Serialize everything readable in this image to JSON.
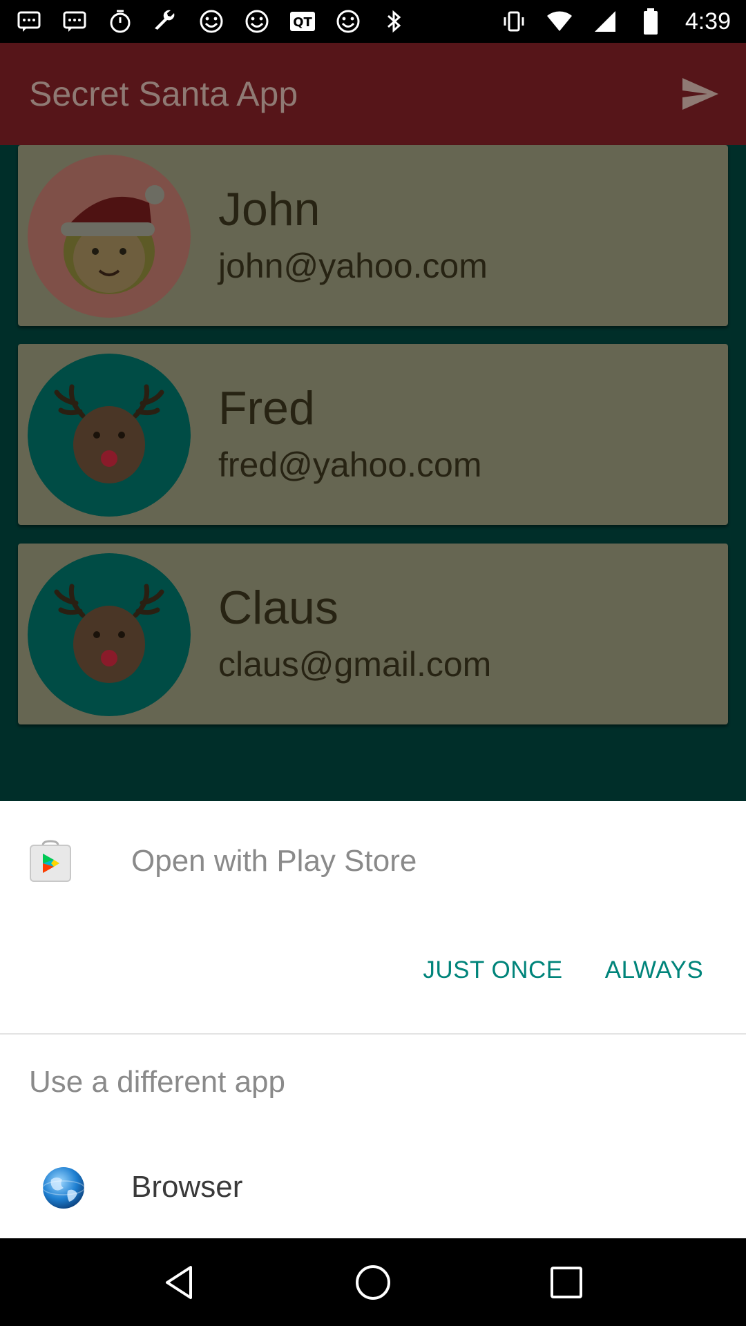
{
  "status_bar": {
    "time": "4:39",
    "left_icons": [
      "notification-icon",
      "notification-icon",
      "timer-icon",
      "wrench-icon",
      "smiley-icon",
      "smiley-icon",
      "qt-app-icon",
      "smiley-icon",
      "bluetooth-icon"
    ],
    "right_icons": [
      "vibrate-icon",
      "wifi-icon",
      "signal-icon",
      "battery-icon"
    ]
  },
  "app_bar": {
    "title": "Secret Santa App",
    "send_icon": "send-icon"
  },
  "contacts": [
    {
      "name": "John",
      "email": "john@yahoo.com",
      "avatar": "santa-girl-avatar"
    },
    {
      "name": "Fred",
      "email": "fred@yahoo.com",
      "avatar": "reindeer-avatar"
    },
    {
      "name": "Claus",
      "email": "claus@gmail.com",
      "avatar": "reindeer-avatar"
    }
  ],
  "dialog": {
    "open_with": "Open with Play Store",
    "just_once": "JUST ONCE",
    "always": "ALWAYS",
    "different_app": "Use a different app",
    "browser_label": "Browser"
  },
  "colors": {
    "app_bar_dimmed": "#561519",
    "card_dimmed": "#666652",
    "content_bg_dimmed": "#002e29",
    "button_accent": "#00847a"
  }
}
